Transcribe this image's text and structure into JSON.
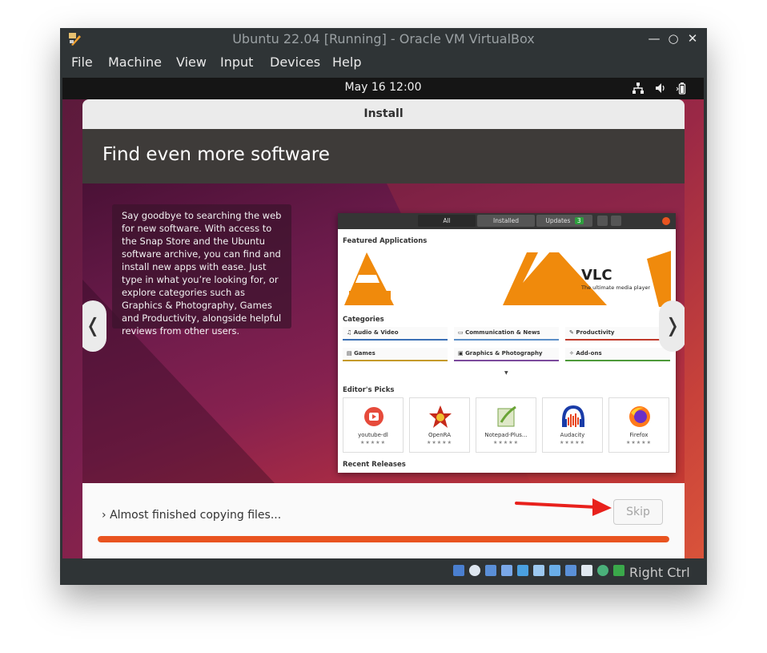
{
  "window": {
    "title": "Ubuntu 22.04 [Running] - Oracle VM VirtualBox",
    "controls": [
      "minimize-icon",
      "maximize-icon",
      "close-icon"
    ],
    "control_glyphs": {
      "minimize": "—",
      "maximize": "○",
      "close": "✕"
    }
  },
  "menubar": {
    "items": [
      "File",
      "Machine",
      "View",
      "Input",
      "Devices",
      "Help"
    ]
  },
  "guest_topbar": {
    "clock": "May 16  12:00",
    "tray_icons": [
      "network-icon",
      "volume-icon",
      "battery-icon"
    ]
  },
  "installer": {
    "title": "Install",
    "slide_title": "Find even more software",
    "description": "Say goodbye to searching the web for new software. With access to the Snap Store and the Ubuntu software archive, you can find and install new apps with ease. Just type in what you’re looking for, or explore categories such as Graphics & Photography, Games and Productivity, alongside helpful reviews from other users.",
    "prev_glyph": "❬",
    "next_glyph": "❭",
    "status_text": "Almost finished copying files...",
    "status_chevron": "›",
    "skip_label": "Skip",
    "progress": 1.0,
    "accent_color": "#e95420"
  },
  "store": {
    "tabs": [
      "All",
      "Installed",
      "Updates"
    ],
    "updates_badge": "3",
    "featured_heading": "Featured Applications",
    "hero_title": "VLC",
    "hero_subtitle": "The ultimate media player",
    "categories_heading": "Categories",
    "categories": [
      {
        "label": "Audio & Video",
        "color": "#3a6fb5"
      },
      {
        "label": "Communication & News",
        "color": "#5b8fc7"
      },
      {
        "label": "Productivity",
        "color": "#c0392b"
      },
      {
        "label": "Games",
        "color": "#c59a2a"
      },
      {
        "label": "Graphics & Photography",
        "color": "#7b4a9c"
      },
      {
        "label": "Add-ons",
        "color": "#4e9a3a"
      }
    ],
    "editors_heading": "Editor's Picks",
    "picks": [
      {
        "name": "youtube-dl",
        "stars": "★★★★★"
      },
      {
        "name": "OpenRA",
        "stars": "★★★★★"
      },
      {
        "name": "Notepad-Plus...",
        "stars": "★★★★★"
      },
      {
        "name": "Audacity",
        "stars": "★★★★★"
      },
      {
        "name": "Firefox",
        "stars": "★★★★★"
      }
    ],
    "recent_heading": "Recent Releases"
  },
  "statusbar": {
    "host_key": "Right Ctrl"
  }
}
